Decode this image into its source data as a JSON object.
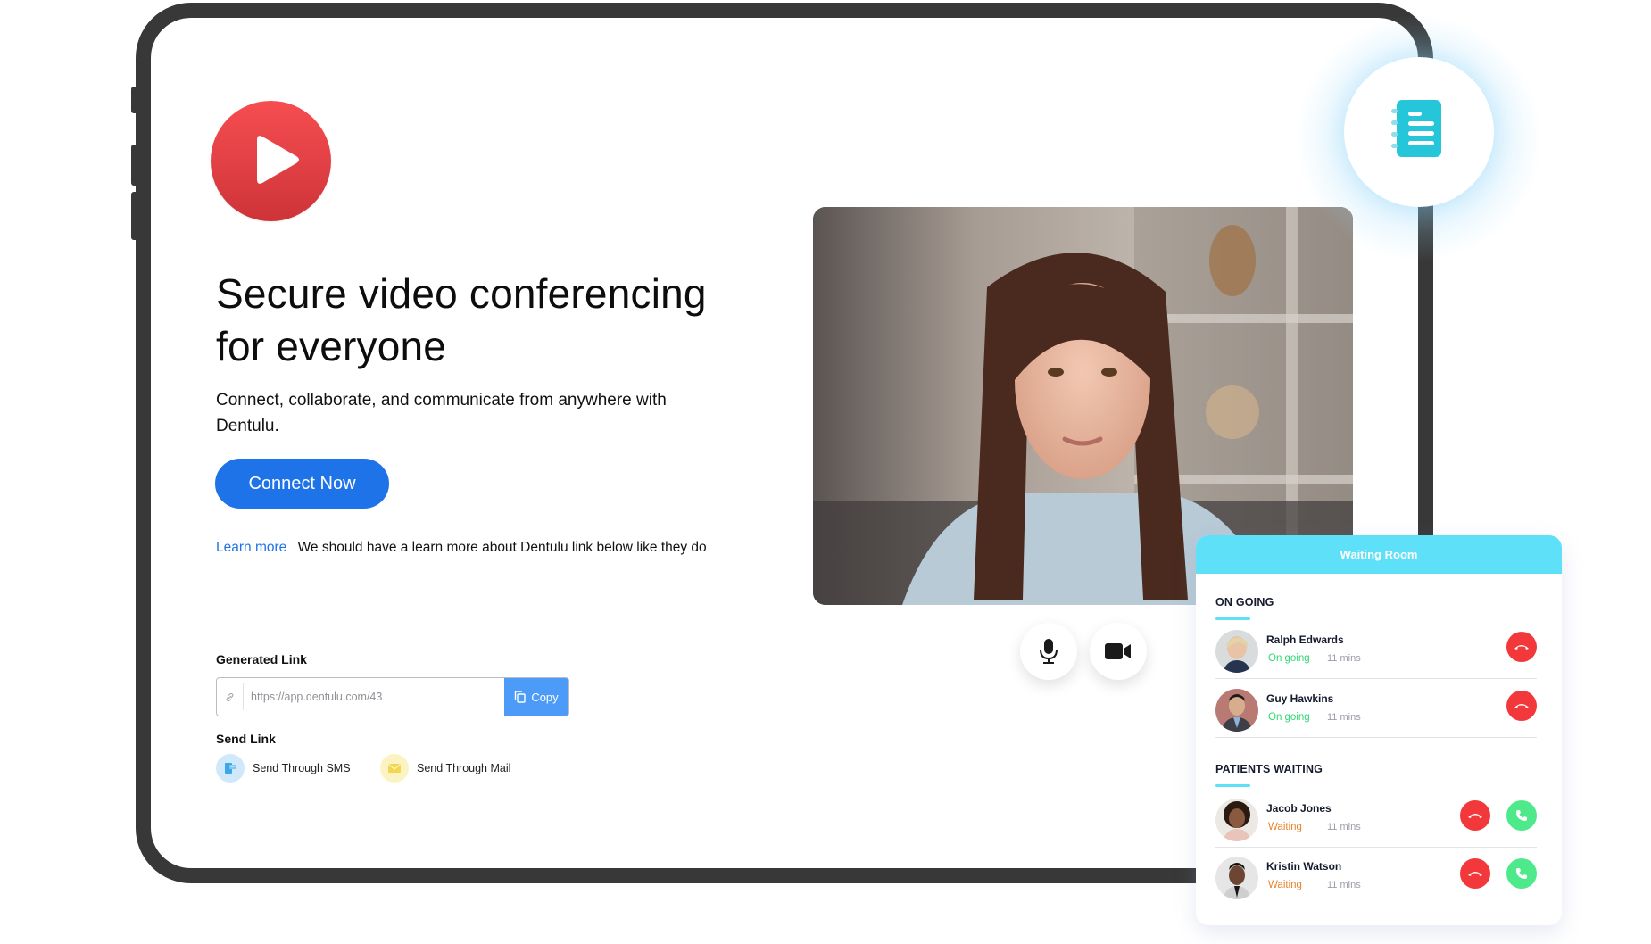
{
  "hero": {
    "play_icon": "play-icon",
    "headline_line1": "Secure video conferencing",
    "headline_line2": "for everyone",
    "subtext": "Connect, collaborate, and communicate from anywhere with Dentulu.",
    "connect_button": "Connect Now",
    "learn_more_link": "Learn more",
    "learn_more_note": "We should have a learn more about Dentulu link below like they do"
  },
  "link_panel": {
    "generated_label": "Generated Link",
    "link_value": "https://app.dentulu.com/43",
    "link_icon": "link-icon",
    "copy_label": "Copy",
    "copy_icon": "copy-icon",
    "send_label": "Send Link",
    "send_options": [
      {
        "label": "Send Through SMS",
        "icon": "sms-icon",
        "color": "#cfe9fa"
      },
      {
        "label": "Send Through Mail",
        "icon": "mail-icon",
        "color": "#fbf4c2"
      }
    ]
  },
  "video_controls": {
    "mic_icon": "microphone-icon",
    "camera_icon": "video-camera-icon"
  },
  "notes_icon": "notebook-icon",
  "waiting_room": {
    "title": "Waiting Room",
    "ongoing_title": "ON GOING",
    "waiting_title": "PATIENTS WAITING",
    "ongoing": [
      {
        "name": "Ralph Edwards",
        "status": "On going",
        "time": "11 mins"
      },
      {
        "name": "Guy Hawkins",
        "status": "On going",
        "time": "11 mins"
      }
    ],
    "waiting": [
      {
        "name": "Jacob Jones",
        "status": "Waiting",
        "time": "11 mins"
      },
      {
        "name": "Kristin Watson",
        "status": "Waiting",
        "time": "11 mins"
      }
    ]
  },
  "colors": {
    "primary": "#1e73e8",
    "accent_cyan": "#5ee0f9",
    "decline_red": "#f2383b",
    "accept_green": "#4de98a",
    "ongoing_green": "#2ed873",
    "waiting_orange": "#e8842a",
    "play_red": "#e04044",
    "notebook_teal": "#26c6da"
  }
}
